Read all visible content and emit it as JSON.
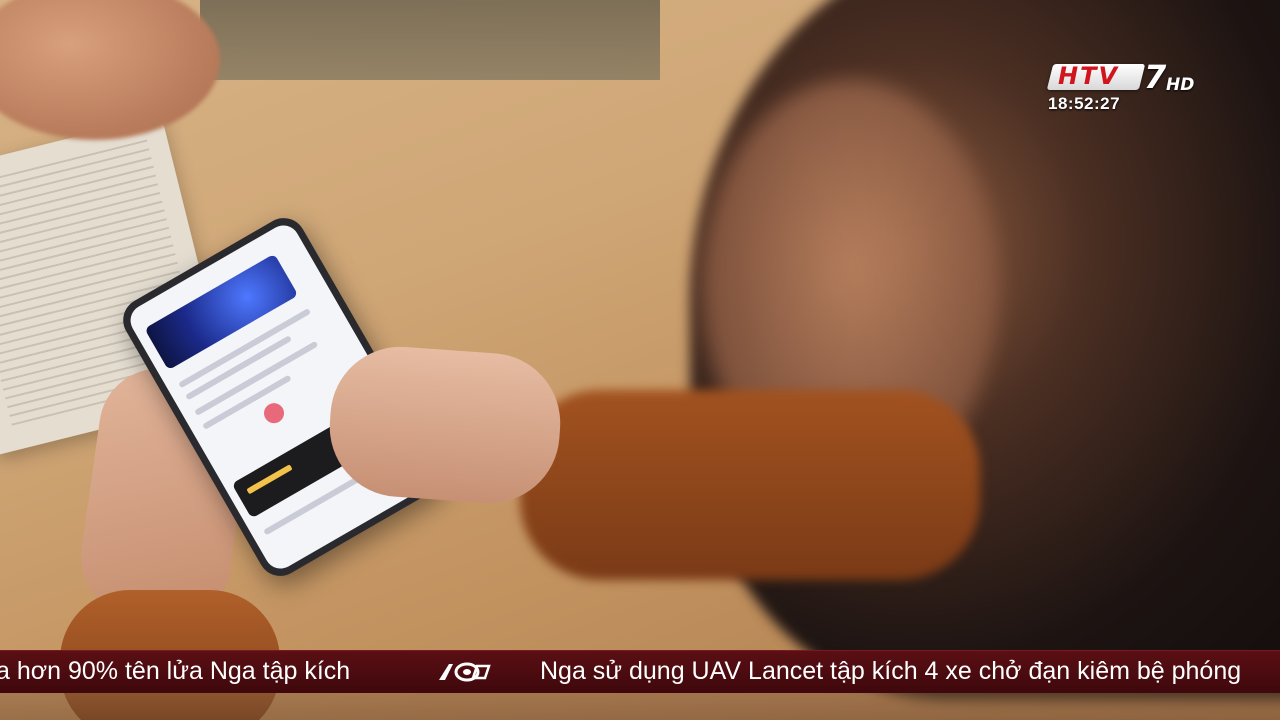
{
  "broadcast": {
    "channel_logo_text": "HTV",
    "channel_logo_number": "7",
    "channel_logo_hd": "HD",
    "time": "18:52:27"
  },
  "ticker": {
    "left_text": "a hơn 90% tên lửa Nga tập kích",
    "right_text": "Nga sử dụng UAV Lancet tập kích 4 xe chở đạn kiêm bệ phóng",
    "separator_icon": "htv-60-logo-icon"
  },
  "colors": {
    "ticker_bg": "#4a0b10",
    "logo_red": "#d0151f"
  }
}
